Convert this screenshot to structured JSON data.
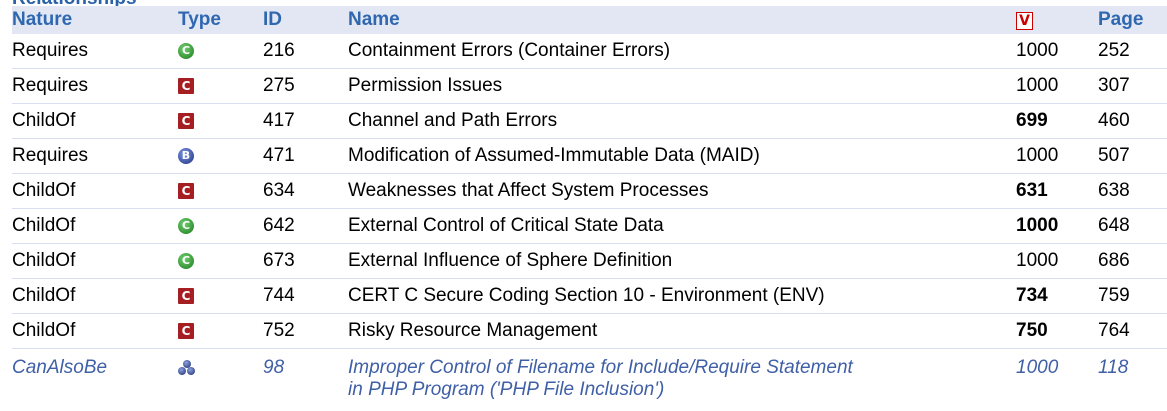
{
  "section": {
    "title": "Relationships"
  },
  "table": {
    "headers": {
      "nature": "Nature",
      "type": "Type",
      "id": "ID",
      "name": "Name",
      "view": "V",
      "page": "Page"
    },
    "rows": [
      {
        "nature": "Requires",
        "type": "Category-green-circle",
        "id": "216",
        "name": "Containment Errors (Container Errors)",
        "view": "1000",
        "page": "252"
      },
      {
        "nature": "Requires",
        "type": "Category-red-square",
        "id": "275",
        "name": "Permission Issues",
        "view": "1000",
        "page": "307"
      },
      {
        "nature": "ChildOf",
        "type": "Category-red-square",
        "id": "417",
        "name": "Channel and Path Errors",
        "view": "699",
        "page": "460"
      },
      {
        "nature": "Requires",
        "type": "Base-blue-circle",
        "id": "471",
        "name": "Modification of Assumed-Immutable Data (MAID)",
        "view": "1000",
        "page": "507"
      },
      {
        "nature": "ChildOf",
        "type": "Category-red-square",
        "id": "634",
        "name": "Weaknesses that Affect System Processes",
        "view": "631",
        "page": "638"
      },
      {
        "nature": "ChildOf",
        "type": "Category-green-circle",
        "id": "642",
        "name": "External Control of Critical State Data",
        "view": "1000",
        "page": "648"
      },
      {
        "nature": "ChildOf",
        "type": "Category-green-circle",
        "id": "673",
        "name": "External Influence of Sphere Definition",
        "view": "1000",
        "page": "686"
      },
      {
        "nature": "ChildOf",
        "type": "Category-red-square",
        "id": "744",
        "name": "CERT C Secure Coding Section 10 - Environment (ENV)",
        "view": "734",
        "page": "759"
      },
      {
        "nature": "ChildOf",
        "type": "Category-red-square",
        "id": "752",
        "name": "Risky Resource Management",
        "view": "750",
        "page": "764"
      }
    ],
    "last_row": {
      "nature": "CanAlsoBe",
      "type": "Compound-cluster",
      "id": "98",
      "name_line1": "Improper Control of Filename for Include/Require Statement",
      "name_line2": "in PHP Program ('PHP File Inclusion')",
      "view": "1000",
      "page": "118"
    },
    "icon_letters": {
      "green": "C",
      "red": "C",
      "blue": "B"
    }
  }
}
